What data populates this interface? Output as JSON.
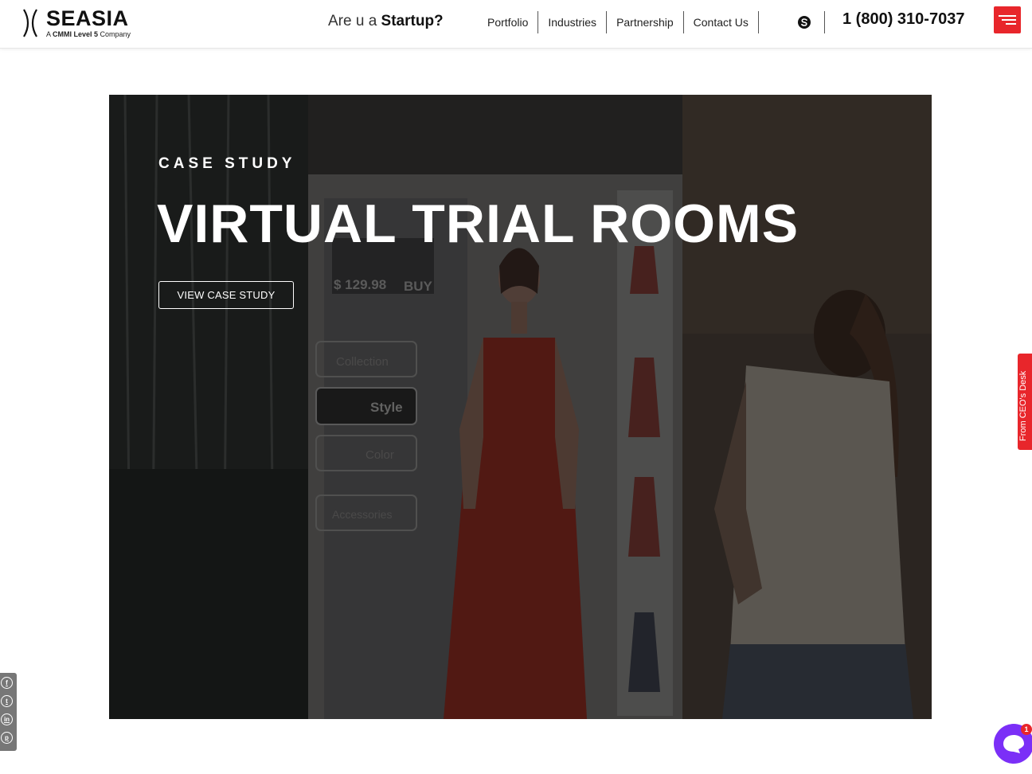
{
  "header": {
    "brand": "SEASIA",
    "tagline_prefix": "A ",
    "tagline_bold": "CMMI Level 5",
    "tagline_suffix": " Company",
    "startup_prefix": "Are u a ",
    "startup_bold": "Startup?",
    "nav": [
      {
        "label": "Portfolio"
      },
      {
        "label": "Industries"
      },
      {
        "label": "Partnership"
      },
      {
        "label": "Contact Us"
      }
    ],
    "phone": "1 (800) 310-7037",
    "skype_icon": "skype-icon",
    "menu_icon": "hamburger-menu-icon"
  },
  "hero": {
    "eyebrow": "CASE STUDY",
    "title": "VIRTUAL TRIAL ROOMS",
    "cta_label": "VIEW CASE STUDY",
    "image_texts": {
      "price": "$ 129.98",
      "buy": "BUY",
      "collection": "Collection",
      "style": "Style",
      "color": "Color",
      "accessories": "Accessories"
    }
  },
  "side_tab": {
    "label": "From CEO's Desk"
  },
  "social": [
    {
      "icon": "facebook-icon",
      "glyph": "f"
    },
    {
      "icon": "twitter-icon",
      "glyph": "t"
    },
    {
      "icon": "linkedin-icon",
      "glyph": "in"
    },
    {
      "icon": "pinterest-icon",
      "glyph": "p"
    }
  ],
  "chat": {
    "badge": "1"
  },
  "colors": {
    "accent": "#e8262b",
    "chat": "#7b2ff7"
  }
}
